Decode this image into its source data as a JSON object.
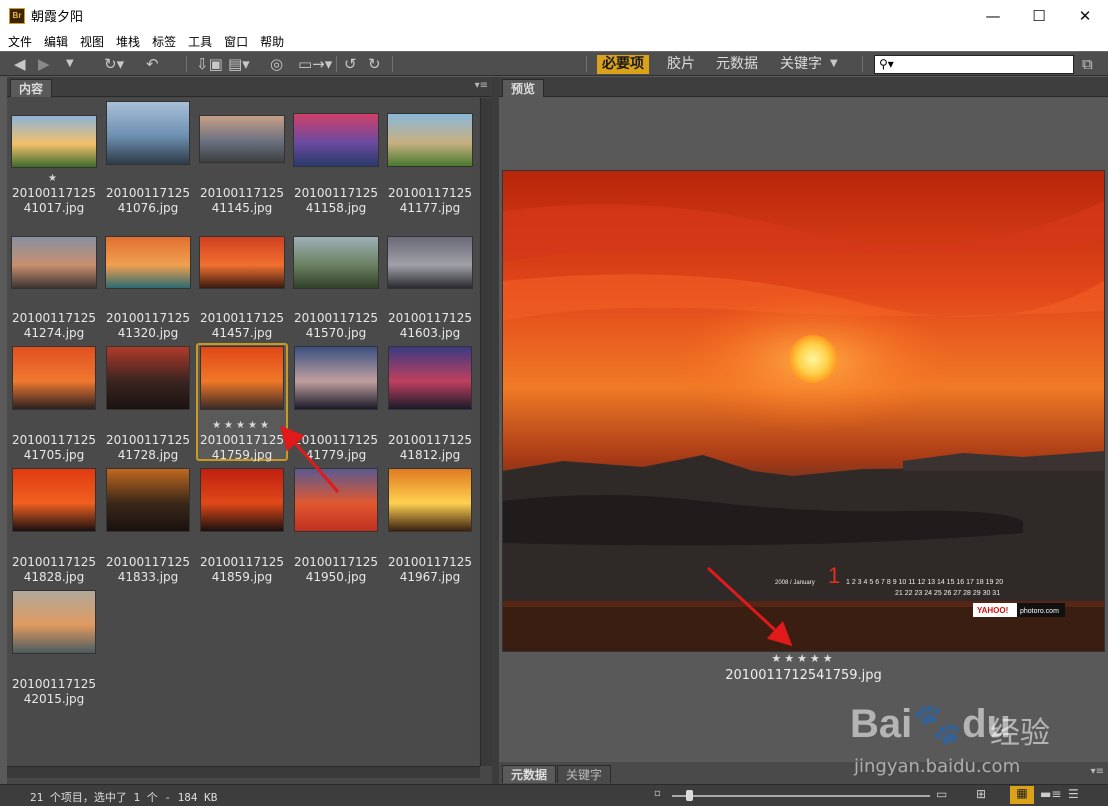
{
  "window": {
    "title": "朝霞夕阳",
    "app_badge": "Br",
    "minimize": "—",
    "maximize": "☐",
    "close": "✕"
  },
  "menu": [
    "文件",
    "编辑",
    "视图",
    "堆栈",
    "标签",
    "工具",
    "窗口",
    "帮助"
  ],
  "toolbar": {
    "workspaces": [
      "必要项",
      "胶片",
      "元数据",
      "关键字"
    ],
    "active_workspace": "必要项",
    "search_value": "⚲▾"
  },
  "content_panel": {
    "tab": "内容"
  },
  "thumbnails": [
    {
      "l1": "20100117125",
      "l2": "41017.jpg",
      "stars": "★"
    },
    {
      "l1": "20100117125",
      "l2": "41076.jpg",
      "stars": ""
    },
    {
      "l1": "20100117125",
      "l2": "41145.jpg",
      "stars": ""
    },
    {
      "l1": "20100117125",
      "l2": "41158.jpg",
      "stars": ""
    },
    {
      "l1": "20100117125",
      "l2": "41177.jpg",
      "stars": ""
    },
    {
      "l1": "20100117125",
      "l2": "41274.jpg",
      "stars": ""
    },
    {
      "l1": "20100117125",
      "l2": "41320.jpg",
      "stars": ""
    },
    {
      "l1": "20100117125",
      "l2": "41457.jpg",
      "stars": ""
    },
    {
      "l1": "20100117125",
      "l2": "41570.jpg",
      "stars": ""
    },
    {
      "l1": "20100117125",
      "l2": "41603.jpg",
      "stars": ""
    },
    {
      "l1": "20100117125",
      "l2": "41705.jpg",
      "stars": ""
    },
    {
      "l1": "20100117125",
      "l2": "41728.jpg",
      "stars": ""
    },
    {
      "l1": "20100117125",
      "l2": "41759.jpg",
      "stars": "★★★★★"
    },
    {
      "l1": "20100117125",
      "l2": "41779.jpg",
      "stars": ""
    },
    {
      "l1": "20100117125",
      "l2": "41812.jpg",
      "stars": ""
    },
    {
      "l1": "20100117125",
      "l2": "41828.jpg",
      "stars": ""
    },
    {
      "l1": "20100117125",
      "l2": "41833.jpg",
      "stars": ""
    },
    {
      "l1": "20100117125",
      "l2": "41859.jpg",
      "stars": ""
    },
    {
      "l1": "20100117125",
      "l2": "41950.jpg",
      "stars": ""
    },
    {
      "l1": "20100117125",
      "l2": "41967.jpg",
      "stars": ""
    },
    {
      "l1": "20100117125",
      "l2": "42015.jpg",
      "stars": ""
    }
  ],
  "selected_index": 12,
  "preview_panel": {
    "tab": "预览",
    "stars": "★★★★★",
    "filename": "2010011712541759.jpg",
    "calendar": {
      "month_big": "1",
      "label": "2008 / January",
      "row1": "1 2 3 4 5 6 7 8 9 10 11 12 13 14 15 16 17 18 19 20",
      "row2": "21 22 23 24 25 26 27 28 29 30 31",
      "brand1": "YAHOO!",
      "brand2": "photoro.com"
    }
  },
  "bottom_tabs": [
    "元数据",
    "关键字"
  ],
  "status": "21 个项目，选中了 1 个 - 184 KB",
  "watermark": {
    "brand": "Bai",
    "brand2": "du",
    "label": "经验",
    "url": "jingyan.baidu.com"
  }
}
